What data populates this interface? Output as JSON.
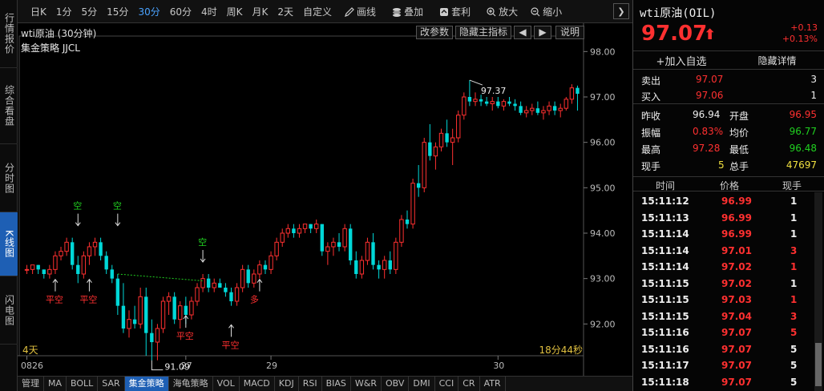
{
  "left_tabs": [
    {
      "label": "行情报价",
      "active": false
    },
    {
      "label": "综合看盘",
      "active": false
    },
    {
      "label": "分时图",
      "active": false
    },
    {
      "label": "K线图",
      "active": true
    },
    {
      "label": "闪电图",
      "active": false
    }
  ],
  "toolbar": {
    "periods": [
      "日K",
      "1分",
      "5分",
      "15分",
      "30分",
      "60分",
      "4时",
      "周K",
      "月K",
      "2天",
      "自定义"
    ],
    "active_period": "30分",
    "draw_label": "画线",
    "overlay_label": "叠加",
    "arbitrage_label": "套利",
    "zoom_in_label": "放大",
    "zoom_out_label": "缩小",
    "collapse_glyph": "❯"
  },
  "chart": {
    "title": "wti原油 (30分钟)",
    "strategy": "集金策略 JJCL",
    "buttons": {
      "params": "改参数",
      "hide_main": "隐藏主指标",
      "left": "◀",
      "right": "▶",
      "help": "说明"
    },
    "days_label": "4天",
    "countdown": "18分44秒",
    "accent_up": "#ff3030",
    "accent_down": "#00d8d8"
  },
  "chart_data": {
    "type": "candlestick",
    "y_ticks": [
      "98.00",
      "97.00",
      "96.00",
      "95.00",
      "94.00",
      "93.00",
      "92.00"
    ],
    "ylim": [
      91.3,
      98.2
    ],
    "x_labels": [
      {
        "label": "0826",
        "index": 0
      },
      {
        "label": "27",
        "index": 28
      },
      {
        "label": "29",
        "index": 43
      },
      {
        "label": "30",
        "index": 83
      }
    ],
    "candles": [
      [
        93.2,
        93.3,
        93.1,
        93.2
      ],
      [
        93.2,
        93.3,
        93.1,
        93.3
      ],
      [
        93.3,
        93.3,
        93.1,
        93.2
      ],
      [
        93.2,
        93.2,
        93.0,
        93.1
      ],
      [
        93.1,
        93.3,
        93.0,
        93.2
      ],
      [
        93.2,
        93.6,
        93.1,
        93.5
      ],
      [
        93.5,
        93.7,
        93.4,
        93.6
      ],
      [
        93.6,
        93.9,
        93.5,
        93.8
      ],
      [
        93.8,
        93.9,
        93.2,
        93.3
      ],
      [
        93.3,
        93.5,
        92.9,
        93.1
      ],
      [
        93.1,
        93.6,
        93.0,
        93.5
      ],
      [
        93.5,
        93.8,
        93.3,
        93.7
      ],
      [
        93.7,
        93.9,
        93.5,
        93.8
      ],
      [
        93.8,
        93.9,
        93.4,
        93.5
      ],
      [
        93.5,
        93.6,
        93.1,
        93.2
      ],
      [
        93.2,
        93.3,
        92.9,
        93.0
      ],
      [
        93.0,
        93.1,
        92.2,
        92.4
      ],
      [
        92.4,
        92.9,
        91.8,
        91.9
      ],
      [
        91.9,
        92.3,
        91.7,
        92.1
      ],
      [
        92.1,
        92.4,
        91.9,
        92.0
      ],
      [
        92.0,
        92.8,
        91.9,
        92.6
      ],
      [
        92.6,
        92.8,
        91.3,
        91.8
      ],
      [
        91.8,
        92.1,
        91.2,
        91.6
      ],
      [
        91.6,
        92.0,
        91.2,
        91.9
      ],
      [
        91.9,
        92.6,
        91.8,
        92.5
      ],
      [
        92.5,
        92.7,
        92.2,
        92.6
      ],
      [
        92.6,
        92.7,
        92.0,
        92.1
      ],
      [
        92.1,
        92.5,
        91.9,
        92.4
      ],
      [
        92.4,
        92.6,
        92.0,
        92.2
      ],
      [
        92.2,
        92.6,
        92.1,
        92.5
      ],
      [
        92.5,
        92.9,
        92.4,
        92.8
      ],
      [
        92.8,
        93.1,
        92.7,
        93.0
      ],
      [
        93.0,
        93.1,
        92.7,
        92.8
      ],
      [
        92.8,
        93.0,
        92.7,
        92.9
      ],
      [
        92.9,
        93.0,
        92.8,
        92.8
      ],
      [
        92.8,
        92.9,
        92.6,
        92.7
      ],
      [
        92.7,
        92.8,
        92.4,
        92.5
      ],
      [
        92.5,
        92.9,
        92.4,
        92.8
      ],
      [
        92.8,
        93.3,
        92.7,
        93.2
      ],
      [
        93.2,
        93.3,
        92.8,
        92.9
      ],
      [
        92.9,
        93.2,
        92.8,
        93.1
      ],
      [
        93.1,
        93.4,
        93.0,
        93.3
      ],
      [
        93.3,
        93.4,
        93.1,
        93.2
      ],
      [
        93.2,
        93.6,
        93.1,
        93.5
      ],
      [
        93.5,
        93.9,
        93.4,
        93.8
      ],
      [
        93.8,
        94.1,
        93.7,
        94.0
      ],
      [
        94.0,
        94.2,
        93.9,
        94.1
      ],
      [
        94.1,
        94.2,
        93.9,
        94.0
      ],
      [
        94.0,
        94.2,
        93.9,
        94.1
      ],
      [
        94.1,
        94.2,
        94.0,
        94.2
      ],
      [
        94.2,
        94.2,
        94.0,
        94.1
      ],
      [
        94.1,
        94.3,
        94.0,
        94.2
      ],
      [
        94.2,
        94.2,
        93.5,
        93.6
      ],
      [
        93.6,
        93.8,
        93.3,
        93.7
      ],
      [
        93.7,
        93.9,
        93.5,
        93.8
      ],
      [
        93.8,
        94.0,
        93.6,
        93.7
      ],
      [
        93.7,
        94.2,
        93.6,
        94.1
      ],
      [
        94.1,
        94.2,
        93.3,
        93.4
      ],
      [
        93.4,
        93.6,
        93.0,
        93.1
      ],
      [
        93.1,
        93.5,
        93.0,
        93.4
      ],
      [
        93.4,
        93.9,
        93.3,
        93.8
      ],
      [
        93.8,
        94.0,
        93.2,
        93.3
      ],
      [
        93.3,
        93.4,
        93.0,
        93.2
      ],
      [
        93.2,
        93.5,
        93.0,
        93.4
      ],
      [
        93.4,
        93.6,
        93.1,
        93.2
      ],
      [
        93.2,
        93.9,
        93.1,
        93.8
      ],
      [
        93.8,
        94.4,
        93.7,
        94.3
      ],
      [
        94.3,
        94.5,
        94.1,
        94.2
      ],
      [
        94.2,
        95.2,
        94.1,
        95.1
      ],
      [
        95.1,
        95.5,
        94.8,
        95.0
      ],
      [
        95.0,
        96.1,
        94.9,
        96.0
      ],
      [
        96.0,
        96.4,
        95.6,
        95.7
      ],
      [
        95.7,
        96.0,
        95.4,
        95.9
      ],
      [
        95.9,
        96.3,
        95.8,
        96.2
      ],
      [
        96.2,
        96.5,
        95.9,
        96.0
      ],
      [
        96.0,
        96.3,
        95.5,
        96.1
      ],
      [
        96.1,
        96.7,
        96.0,
        96.6
      ],
      [
        96.6,
        97.1,
        96.5,
        97.0
      ],
      [
        97.0,
        97.37,
        96.8,
        96.9
      ],
      [
        96.9,
        97.1,
        96.8,
        96.95
      ],
      [
        96.95,
        97.05,
        96.8,
        96.9
      ],
      [
        96.9,
        97.0,
        96.8,
        96.85
      ],
      [
        96.85,
        97.0,
        96.7,
        96.9
      ],
      [
        96.9,
        97.0,
        96.75,
        96.8
      ],
      [
        96.8,
        96.95,
        96.7,
        96.9
      ],
      [
        96.9,
        97.0,
        96.8,
        96.85
      ],
      [
        96.85,
        96.95,
        96.7,
        96.8
      ],
      [
        96.8,
        96.9,
        96.6,
        96.65
      ],
      [
        96.65,
        96.8,
        96.55,
        96.7
      ],
      [
        96.7,
        96.85,
        96.6,
        96.75
      ],
      [
        96.75,
        96.9,
        96.6,
        96.65
      ],
      [
        96.65,
        96.8,
        96.5,
        96.7
      ],
      [
        96.7,
        96.9,
        96.6,
        96.8
      ],
      [
        96.8,
        96.9,
        96.6,
        96.7
      ],
      [
        96.7,
        96.85,
        96.55,
        96.75
      ],
      [
        96.75,
        97.0,
        96.7,
        96.95
      ],
      [
        96.95,
        97.28,
        96.85,
        97.2
      ],
      [
        97.2,
        97.25,
        96.7,
        97.07
      ]
    ],
    "annotations": [
      {
        "text": "平空",
        "index": 5,
        "price": 93.0,
        "side": "below",
        "color": "#ff3030"
      },
      {
        "text": "空",
        "index": 9,
        "price": 93.9,
        "side": "above",
        "color": "#20d020"
      },
      {
        "text": "平空",
        "index": 11,
        "price": 93.0,
        "side": "below",
        "color": "#ff3030"
      },
      {
        "text": "空",
        "index": 16,
        "price": 93.9,
        "side": "above",
        "color": "#20d020"
      },
      {
        "text": "平空",
        "index": 28,
        "price": 92.2,
        "side": "below",
        "color": "#ff3030"
      },
      {
        "text": "空",
        "index": 31,
        "price": 93.1,
        "side": "above",
        "color": "#20d020"
      },
      {
        "text": "平空",
        "index": 36,
        "price": 92.0,
        "side": "below",
        "color": "#ff3030"
      },
      {
        "text": "多",
        "index": 41,
        "price": 93.0,
        "side": "below",
        "color": "#ff3030"
      }
    ],
    "extremes": [
      {
        "label": "97.37",
        "index": 78,
        "price": 97.37
      },
      {
        "label": "91.09",
        "index": 22,
        "price": 91.2
      }
    ]
  },
  "indicator_tabs": {
    "items": [
      "管理",
      "MA",
      "BOLL",
      "SAR",
      "集金策略",
      "海龟策略",
      "VOL",
      "MACD",
      "KDJ",
      "RSI",
      "BIAS",
      "W&R",
      "OBV",
      "DMI",
      "CCI",
      "CR",
      "ATR"
    ],
    "active": "集金策略"
  },
  "quote": {
    "name": "wti原油(OIL)",
    "price": "97.07",
    "arrow": "⬆",
    "change": "+0.13",
    "change_pct": "+0.13%",
    "add_watch": "+加入自选",
    "hide_detail": "隐藏详情",
    "sell": {
      "label": "卖出",
      "price": "97.07",
      "qty": "3"
    },
    "buy": {
      "label": "买入",
      "price": "97.06",
      "qty": "1"
    },
    "stats": [
      {
        "l1": "昨收",
        "v1": "96.94",
        "c1": "white",
        "l2": "开盘",
        "v2": "96.95",
        "c2": "red"
      },
      {
        "l1": "振幅",
        "v1": "0.83%",
        "c1": "red",
        "l2": "均价",
        "v2": "96.77",
        "c2": "green"
      },
      {
        "l1": "最高",
        "v1": "97.28",
        "c1": "red",
        "l2": "最低",
        "v2": "96.48",
        "c2": "green"
      },
      {
        "l1": "现手",
        "v1": "5",
        "c1": "yellow",
        "l2": "总手",
        "v2": "47697",
        "c2": "yellow"
      }
    ],
    "ticks_header": {
      "time": "时间",
      "price": "价格",
      "qty": "现手"
    },
    "ticks": [
      {
        "time": "15:11:12",
        "price": "96.99",
        "qty": "1",
        "qcolor": "white"
      },
      {
        "time": "15:11:13",
        "price": "96.99",
        "qty": "1",
        "qcolor": "white"
      },
      {
        "time": "15:11:14",
        "price": "96.99",
        "qty": "1",
        "qcolor": "white"
      },
      {
        "time": "15:11:14",
        "price": "97.01",
        "qty": "3",
        "qcolor": "red"
      },
      {
        "time": "15:11:14",
        "price": "97.02",
        "qty": "1",
        "qcolor": "red"
      },
      {
        "time": "15:11:15",
        "price": "97.02",
        "qty": "1",
        "qcolor": "white"
      },
      {
        "time": "15:11:15",
        "price": "97.03",
        "qty": "1",
        "qcolor": "red"
      },
      {
        "time": "15:11:15",
        "price": "97.04",
        "qty": "3",
        "qcolor": "red"
      },
      {
        "time": "15:11:16",
        "price": "97.07",
        "qty": "5",
        "qcolor": "red"
      },
      {
        "time": "15:11:16",
        "price": "97.07",
        "qty": "5",
        "qcolor": "white"
      },
      {
        "time": "15:11:17",
        "price": "97.07",
        "qty": "5",
        "qcolor": "white"
      },
      {
        "time": "15:11:18",
        "price": "97.07",
        "qty": "5",
        "qcolor": "white"
      }
    ]
  }
}
